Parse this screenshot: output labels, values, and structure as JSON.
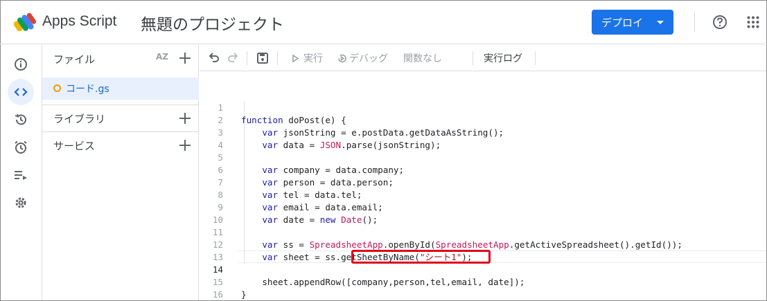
{
  "header": {
    "app_name": "Apps Script",
    "project_title": "無題のプロジェクト",
    "deploy_label": "デプロイ",
    "accent_color": "#1a73e8"
  },
  "rail": {
    "items": [
      "info-icon",
      "code-icon",
      "history-icon",
      "alarm-icon",
      "executions-icon",
      "settings-icon"
    ],
    "active": "code-icon"
  },
  "files_panel": {
    "title": "ファイル",
    "sort_label": "AZ",
    "files": [
      {
        "name": "コード.gs",
        "status_color": "#f29900"
      }
    ],
    "sections": [
      {
        "label": "ライブラリ"
      },
      {
        "label": "サービス"
      }
    ]
  },
  "toolbar": {
    "run_label": "実行",
    "debug_label": "デバッグ",
    "function_label": "関数なし",
    "log_label": "実行ログ"
  },
  "editor": {
    "current_line": 14,
    "lines": [
      {
        "n": "1",
        "text": "function doPost(e) {"
      },
      {
        "n": "2",
        "text": "var jsonString = e.postData.getDataAsString();"
      },
      {
        "n": "3",
        "text": "var data = JSON.parse(jsonString);"
      },
      {
        "n": "4",
        "text": ""
      },
      {
        "n": "5",
        "text": "var company = data.company;"
      },
      {
        "n": "6",
        "text": "var person = data.person;"
      },
      {
        "n": "7",
        "text": "var tel = data.tel;"
      },
      {
        "n": "8",
        "text": "var email = data.email;"
      },
      {
        "n": "9",
        "text": "var date = new Date();"
      },
      {
        "n": "10",
        "text": ""
      },
      {
        "n": "11",
        "text": "var ss = SpreadsheetApp.openById(SpreadsheetApp.getActiveSpreadsheet().getId());"
      },
      {
        "n": "12",
        "text": "var sheet = ss.getSheetByName(\"シート1\");"
      },
      {
        "n": "13",
        "text": ""
      },
      {
        "n": "14",
        "text": "sheet.appendRow([company,person,tel,email, date]);"
      },
      {
        "n": "15",
        "text": "}"
      },
      {
        "n": "16",
        "text": ""
      }
    ],
    "highlight_color": "#e0001b"
  }
}
